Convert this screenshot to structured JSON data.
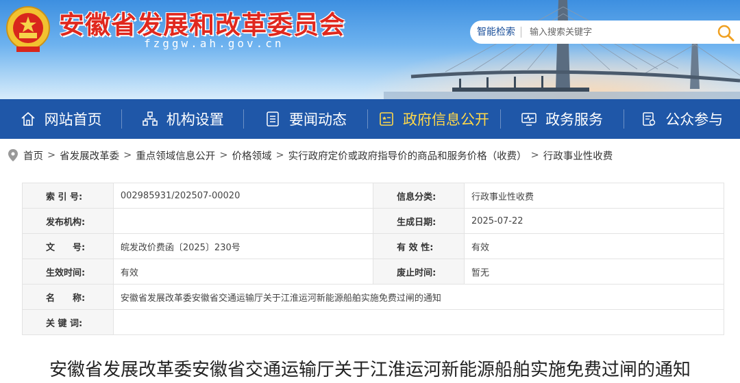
{
  "header": {
    "title": "安徽省发展和改革委员会",
    "domain": "fzggw.ah.gov.cn",
    "search": {
      "label": "智能检索",
      "placeholder": "输入搜索关键字"
    }
  },
  "nav": {
    "items": [
      {
        "label": "网站首页",
        "icon": "home-icon"
      },
      {
        "label": "机构设置",
        "icon": "org-chart-icon"
      },
      {
        "label": "要闻动态",
        "icon": "news-icon"
      },
      {
        "label": "政府信息公开",
        "icon": "info-disclosure-icon",
        "active": true
      },
      {
        "label": "政务服务",
        "icon": "monitor-icon"
      },
      {
        "label": "公众参与",
        "icon": "survey-icon"
      }
    ],
    "active_color": "#ffd84a",
    "bg_color": "#1f57a8"
  },
  "breadcrumb": {
    "items": [
      "首页",
      "省发展改革委",
      "重点领域信息公开",
      "价格领域",
      "实行政府定价或政府指导价的商品和服务价格（收费）",
      "行政事业性收费"
    ],
    "separator": ">"
  },
  "info": {
    "index_label": "索 引 号:",
    "index_value": "002985931/202507-00020",
    "category_label": "信息分类:",
    "category_value": "行政事业性收费",
    "publisher_label": "发布机构:",
    "publisher_value": "",
    "date_label": "生成日期:",
    "date_value": "2025-07-22",
    "docno_label": "文　　号:",
    "docno_value": "皖发改价费函〔2025〕230号",
    "validity_label": "有 效 性:",
    "validity_value": "有效",
    "effective_label": "生效时间:",
    "effective_value": "有效",
    "expire_label": "废止时间:",
    "expire_value": "暂无",
    "name_label": "名　　称:",
    "name_value": "安徽省发展改革委安徽省交通运输厅关于江淮运河新能源船舶实施免费过闸的通知",
    "keywords_label": "关 键 词:",
    "keywords_value": ""
  },
  "document": {
    "title": "安徽省发展改革委安徽省交通运输厅关于江淮运河新能源船舶实施免费过闸的通知"
  }
}
